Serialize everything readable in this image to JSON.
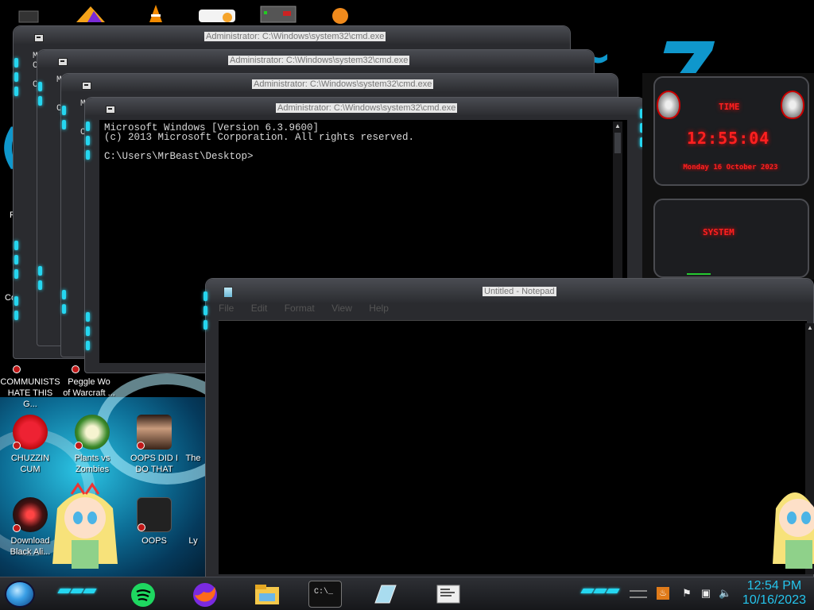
{
  "desktop": {
    "icons": [
      {
        "name": "COMMUNISTS HATE THIS G...",
        "line1": "COMMUNISTS",
        "line2": "HATE THIS G..."
      },
      {
        "name": "Peggle World of Warcraft",
        "line1": "Peggle Wo",
        "line2": "of Warcraft ..."
      },
      {
        "name": "CHUZZIN CUM",
        "line1": "CHUZZIN",
        "line2": "CUM"
      },
      {
        "name": "Plants vs Zombies",
        "line1": "Plants vs",
        "line2": "Zombies"
      },
      {
        "name": "OOPS DID I DO THAT",
        "line1": "OOPS DID I",
        "line2": "DO THAT"
      },
      {
        "name": "The",
        "line1": "The",
        "line2": ""
      },
      {
        "name": "Download Black Ali...",
        "line1": "Download",
        "line2": "Black Ali..."
      },
      {
        "name": "OOPS",
        "line1": "OOPS",
        "line2": ""
      },
      {
        "name": "Ly",
        "line1": "Ly",
        "line2": ""
      }
    ],
    "left_edge_letters": [
      "Re",
      "Co"
    ],
    "colors": {
      "accent_cyan": "#25d6f0",
      "clock_blue": "#25c4ec",
      "gadget_red": "#ff2020"
    }
  },
  "cmd_windows": [
    {
      "title": "Administrator: C:\\Windows\\system32\\cmd.exe"
    },
    {
      "title": "Administrator: C:\\Windows\\system32\\cmd.exe"
    },
    {
      "title": "Administrator: C:\\Windows\\system32\\cmd.exe"
    },
    {
      "title": "Administrator: C:\\Windows\\system32\\cmd.exe"
    }
  ],
  "cmd_side_letters": [
    "M",
    "C",
    "C"
  ],
  "console": {
    "line1": "Microsoft Windows [Version 6.3.9600]",
    "line2": "(c) 2013 Microsoft Corporation. All rights reserved.",
    "line3": "",
    "line4": "C:\\Users\\MrBeast\\Desktop>"
  },
  "notepad": {
    "title": "Untitled - Notepad",
    "menu": [
      "File",
      "Edit",
      "Format",
      "View",
      "Help"
    ]
  },
  "gadget": {
    "time_label": "TIME",
    "time": "12:55:04",
    "date": "Monday 16 October 2023",
    "system_label": "SYSTEM"
  },
  "taskbar": {
    "pinned": [
      "spotify-icon",
      "firefox-icon",
      "file-explorer-icon",
      "cmd-icon",
      "notepad-icon",
      "document-icon"
    ],
    "cmd_button_text": "C:\\_",
    "tray": [
      "java-icon",
      "flag-icon",
      "network-icon",
      "volume-icon"
    ],
    "clock_time": "12:54 PM",
    "clock_date": "10/16/2023"
  }
}
